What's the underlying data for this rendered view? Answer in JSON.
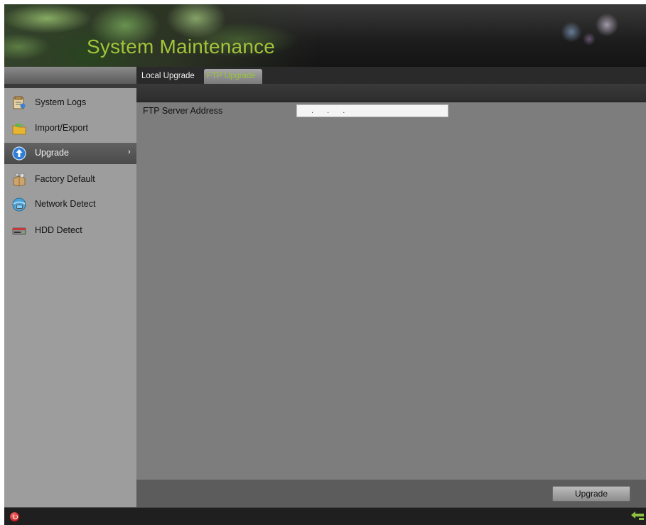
{
  "header": {
    "title": "System Maintenance"
  },
  "tabs": [
    {
      "label": "Local Upgrade",
      "active": false
    },
    {
      "label": "FTP Upgrade",
      "active": true
    }
  ],
  "sidebar": {
    "items": [
      {
        "label": "System Logs",
        "icon": "log-file-icon",
        "active": false
      },
      {
        "label": "Import/Export",
        "icon": "folder-icon",
        "active": false
      },
      {
        "label": "Upgrade",
        "icon": "upgrade-icon",
        "active": true
      },
      {
        "label": "Factory Default",
        "icon": "factory-default-icon",
        "active": false
      },
      {
        "label": "Network Detect",
        "icon": "network-detect-icon",
        "active": false
      },
      {
        "label": "HDD Detect",
        "icon": "hdd-icon",
        "active": false
      }
    ]
  },
  "form": {
    "ftp_server_label": "FTP Server Address",
    "ftp_server_value": ". . ."
  },
  "footer": {
    "upgrade_label": "Upgrade"
  },
  "colors": {
    "accent": "#a3c33a",
    "active_tab_text": "#9ac43c",
    "content_bg": "#7d7d7d",
    "sidebar_bg": "#9d9d9d"
  },
  "status_bar": {
    "left_icon": "power-icon",
    "right_icon": "back-arrow-icon"
  }
}
